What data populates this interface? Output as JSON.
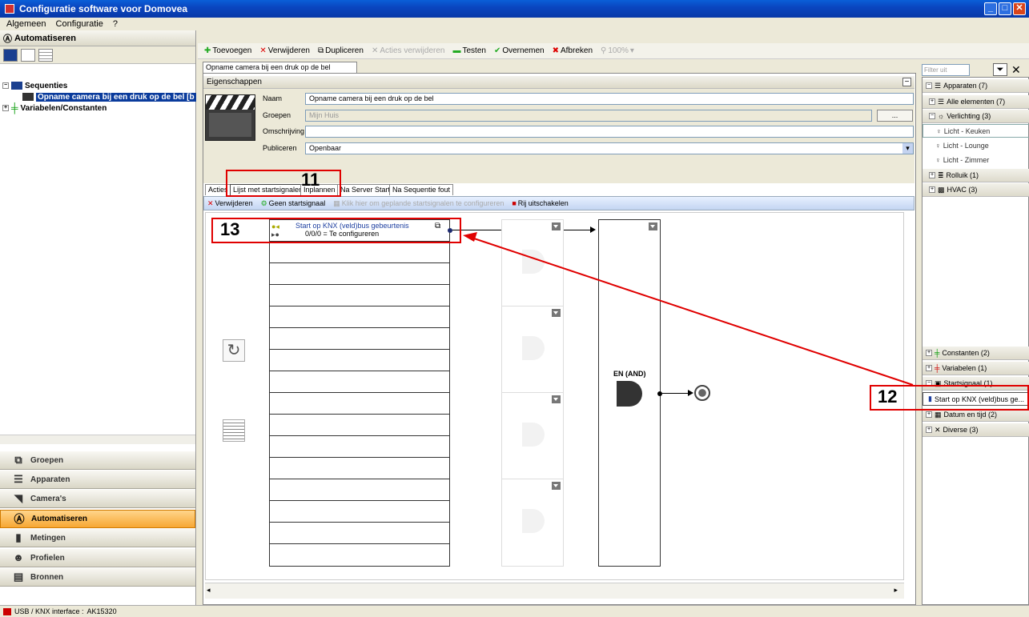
{
  "window": {
    "title": "Configuratie software voor Domovea"
  },
  "menu": [
    "Algemeen",
    "Configuratie",
    "?"
  ],
  "left_panel": {
    "header": "Automatiseren",
    "tree": {
      "sequences": "Sequenties",
      "selected_item": "Opname camera bij een druk op de bel [b",
      "variables": "Variabelen/Constanten"
    },
    "nav": [
      "Groepen",
      "Apparaten",
      "Camera's",
      "Automatiseren",
      "Metingen",
      "Profielen",
      "Bronnen"
    ]
  },
  "toolbar": {
    "add": "Toevoegen",
    "remove": "Verwijderen",
    "duplicate": "Dupliceren",
    "remove_actions": "Acties verwijderen",
    "test": "Testen",
    "accept": "Overnemen",
    "cancel": "Afbreken",
    "zoom": "100%"
  },
  "document_tab": "Opname camera bij een druk op de bel [bijgewerkt]",
  "properties": {
    "header": "Eigenschappen",
    "name_label": "Naam",
    "name_value": "Opname camera bij een druk op de bel",
    "groups_label": "Groepen",
    "groups_value": "Mijn Huis",
    "groups_button": "...",
    "description_label": "Omschrijving",
    "description_value": "",
    "publish_label": "Publiceren",
    "publish_value": "Openbaar"
  },
  "inner_tabs": [
    "Acties",
    "Lijst met startsignalen",
    "Inplannen",
    "Na Server Start",
    "Na Sequentie fout"
  ],
  "inner_toolbar": {
    "remove": "Verwijderen",
    "no_start": "Geen startsignaal",
    "scheduled": "Klik hier om geplande startsignalen te configureren",
    "disable_row": "Rij uitschakelen"
  },
  "canvas": {
    "trigger_title": "Start op KNX (veld)bus gebeurtenis",
    "trigger_address": "0/0/0 = Te configureren",
    "and_label": "EN (AND)"
  },
  "right_panel": {
    "filter_placeholder": "Filter uit",
    "groups": {
      "devices": "Apparaten (7)",
      "all_elements": "Alle elementen (7)",
      "lighting": "Verlichting (3)",
      "light1": "Licht - Keuken",
      "light2": "Licht - Lounge",
      "light3": "Licht - Zimmer",
      "shutter": "Rolluik (1)",
      "hvac": "HVAC (3)",
      "constants": "Constanten (2)",
      "variables": "Variabelen (1)",
      "startsignal": "Startsignaal (1)",
      "startsignal_item": "Start op KNX (veld)bus ge...",
      "datetime": "Datum en tijd (2)",
      "misc": "Diverse (3)"
    }
  },
  "annotations": [
    "11",
    "12",
    "13"
  ],
  "statusbar": {
    "interface": "USB / KNX interface :",
    "device": "AK15320"
  },
  "colors": {
    "title_bar": "#0a46c0",
    "selection": "#0a3b9c",
    "annotation": "#e00000",
    "nav_active": "#f7a733"
  }
}
